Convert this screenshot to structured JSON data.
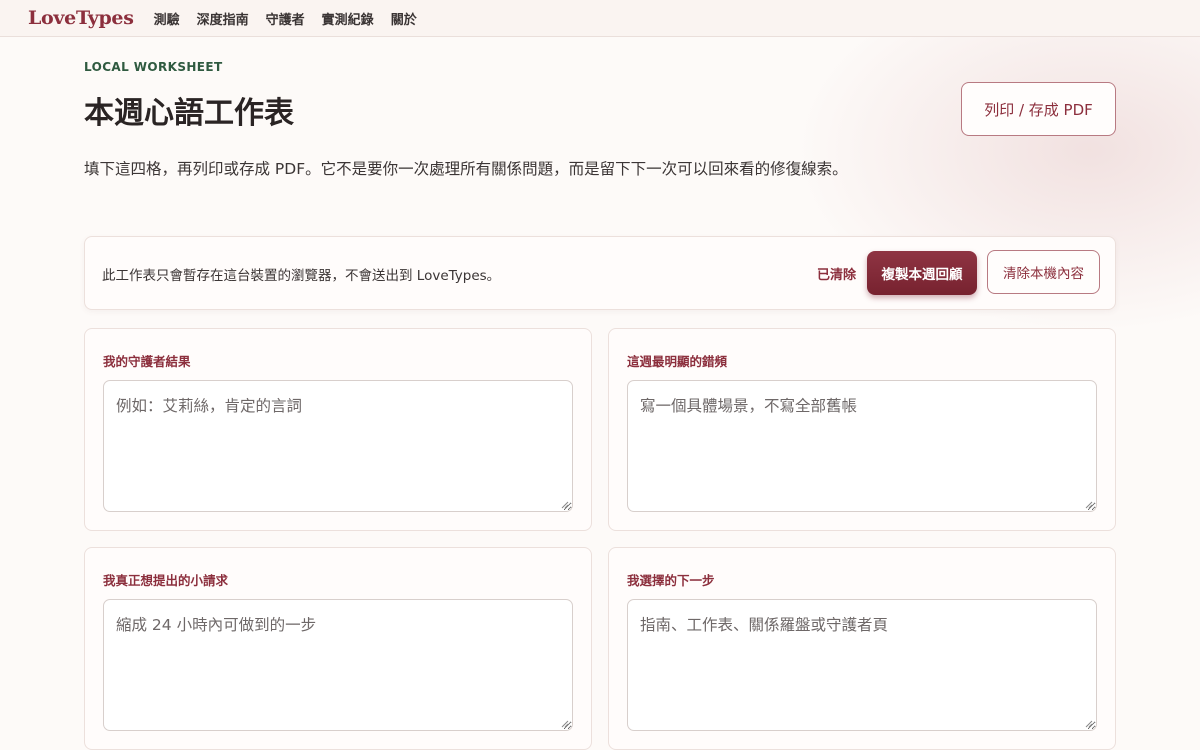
{
  "nav": {
    "brand": "LoveTypes",
    "links": [
      "測驗",
      "深度指南",
      "守護者",
      "實測紀錄",
      "關於"
    ]
  },
  "header": {
    "eyebrow": "LOCAL WORKSHEET",
    "title": "本週心語工作表",
    "print_label": "列印 / 存成 PDF",
    "intro": "填下這四格，再列印或存成 PDF。它不是要你一次處理所有關係問題，而是留下下一次可以回來看的修復線索。"
  },
  "notice": {
    "text": "此工作表只會暫存在這台裝置的瀏覽器，不會送出到 LoveTypes。",
    "status": "已清除",
    "copy_label": "複製本週回顧",
    "clear_label": "清除本機內容"
  },
  "cards": [
    {
      "label": "我的守護者結果",
      "placeholder": "例如：艾莉絲，肯定的言詞",
      "value": ""
    },
    {
      "label": "這週最明顯的錯頻",
      "placeholder": "寫一個具體場景，不寫全部舊帳",
      "value": ""
    },
    {
      "label": "我真正想提出的小請求",
      "placeholder": "縮成 24 小時內可做到的一步",
      "value": ""
    },
    {
      "label": "我選擇的下一步",
      "placeholder": "指南、工作表、關係羅盤或守護者頁",
      "value": ""
    }
  ],
  "colors": {
    "accent": "#8c2f3d",
    "eyebrow": "#2f5a40",
    "background": "#fdfaf8"
  }
}
